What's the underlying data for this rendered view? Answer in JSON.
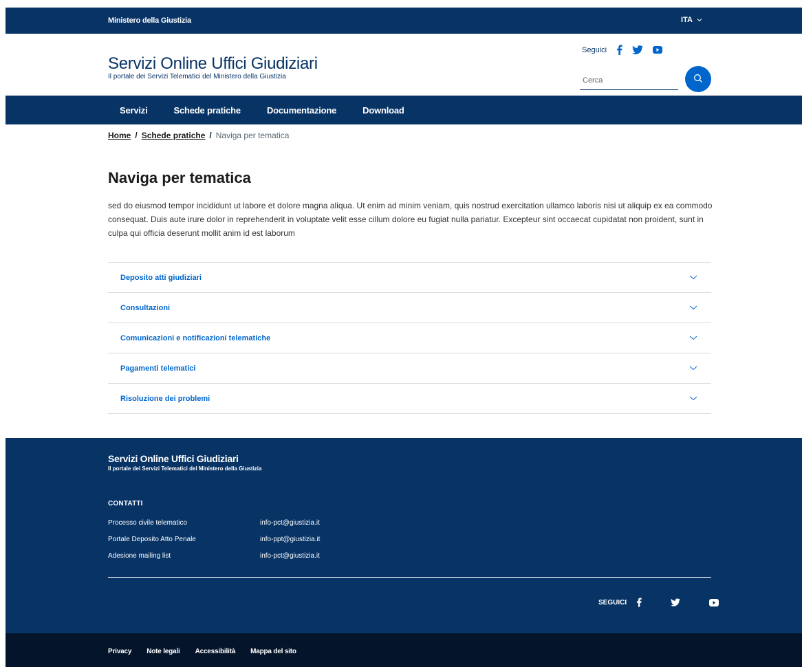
{
  "slimbar": {
    "owner": "Ministero della Giustizia",
    "language": "ITA"
  },
  "header": {
    "title": "Servizi Online Uffici Giudiziari",
    "subtitle": "Il portale dei Servizi Telematici del Ministero della Giustizia",
    "follow_label": "Seguici",
    "search_placeholder": "Cerca"
  },
  "nav": {
    "items": [
      {
        "label": "Servizi"
      },
      {
        "label": "Schede pratiche"
      },
      {
        "label": "Documentazione"
      },
      {
        "label": "Download"
      }
    ]
  },
  "breadcrumb": {
    "home": "Home",
    "sep": "/",
    "section": "Schede pratiche",
    "current": "Naviga per tematica"
  },
  "page": {
    "title": "Naviga per tematica",
    "intro": "sed do eiusmod tempor incididunt ut labore et dolore magna aliqua. Ut enim ad minim veniam, quis nostrud exercitation ullamco laboris nisi ut aliquip ex ea commodo consequat. Duis aute irure dolor in reprehenderit in voluptate velit esse cillum dolore eu fugiat nulla pariatur. Excepteur sint occaecat cupidatat non proident, sunt in culpa qui officia deserunt mollit anim id est laborum"
  },
  "accordion": [
    {
      "label": "Deposito atti giudiziari"
    },
    {
      "label": "Consultazioni"
    },
    {
      "label": "Comunicazioni e notificazioni telematiche"
    },
    {
      "label": "Pagamenti telematici"
    },
    {
      "label": "Risoluzione dei problemi"
    }
  ],
  "footer": {
    "title": "Servizi Online Uffici Giudiziari",
    "subtitle": "Il portale dei Servizi Telematici del Ministero della Giustizia",
    "contacts_heading": "CONTATTI",
    "contacts": [
      {
        "name": "Processo civile telematico",
        "email": "info-pct@giustizia.it"
      },
      {
        "name": "Portale Deposito Atto Penale",
        "email": "info-ppt@giustizia.it"
      },
      {
        "name": "Adesione mailing list",
        "email": "info-pct@giustizia.it"
      }
    ],
    "follow_label": "SEGUICI"
  },
  "bottom_links": [
    {
      "label": "Privacy"
    },
    {
      "label": "Note legali"
    },
    {
      "label": "Accessibilità"
    },
    {
      "label": "Mappa del sito"
    }
  ],
  "colors": {
    "brand_dark": "#073365",
    "accent": "#0066cc",
    "bottom_bar": "#04152b"
  },
  "icons": [
    "chevron-down-icon",
    "facebook-icon",
    "twitter-icon",
    "youtube-icon",
    "search-icon"
  ]
}
